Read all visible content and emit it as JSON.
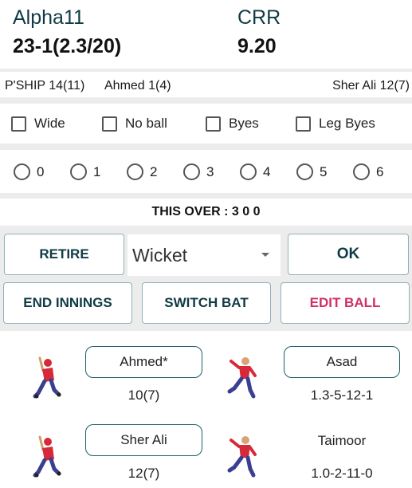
{
  "score": {
    "team": "Alpha11",
    "runs": "23-1(2.3/20)",
    "crr_label": "CRR",
    "crr_value": "9.20"
  },
  "partnership": {
    "pship": "P'SHIP 14(11)",
    "batter1": "Ahmed 1(4)",
    "batter2": "Sher Ali 12(7)"
  },
  "extras": [
    "Wide",
    "No ball",
    "Byes",
    "Leg Byes"
  ],
  "runs_options": [
    "0",
    "1",
    "2",
    "3",
    "4",
    "5",
    "6"
  ],
  "this_over": "THIS OVER : 3 0 0",
  "actions": {
    "retire": "RETIRE",
    "wicket": "Wicket",
    "ok": "OK",
    "end_innings": "END INNINGS",
    "switch_bat": "SWITCH BAT",
    "edit_ball": "EDIT BALL"
  },
  "batters": [
    {
      "name": "Ahmed*",
      "stats": "10(7)"
    },
    {
      "name": "Sher Ali",
      "stats": "12(7)"
    }
  ],
  "bowlers": [
    {
      "name": "Asad",
      "stats": "1.3-5-12-1"
    },
    {
      "name": "Taimoor",
      "stats": "1.0-2-11-0"
    }
  ],
  "colors": {
    "accent": "#0f3a46",
    "edit": "#d0306a",
    "border": "#8fb1b8",
    "avatar_red": "#d62a3a"
  }
}
